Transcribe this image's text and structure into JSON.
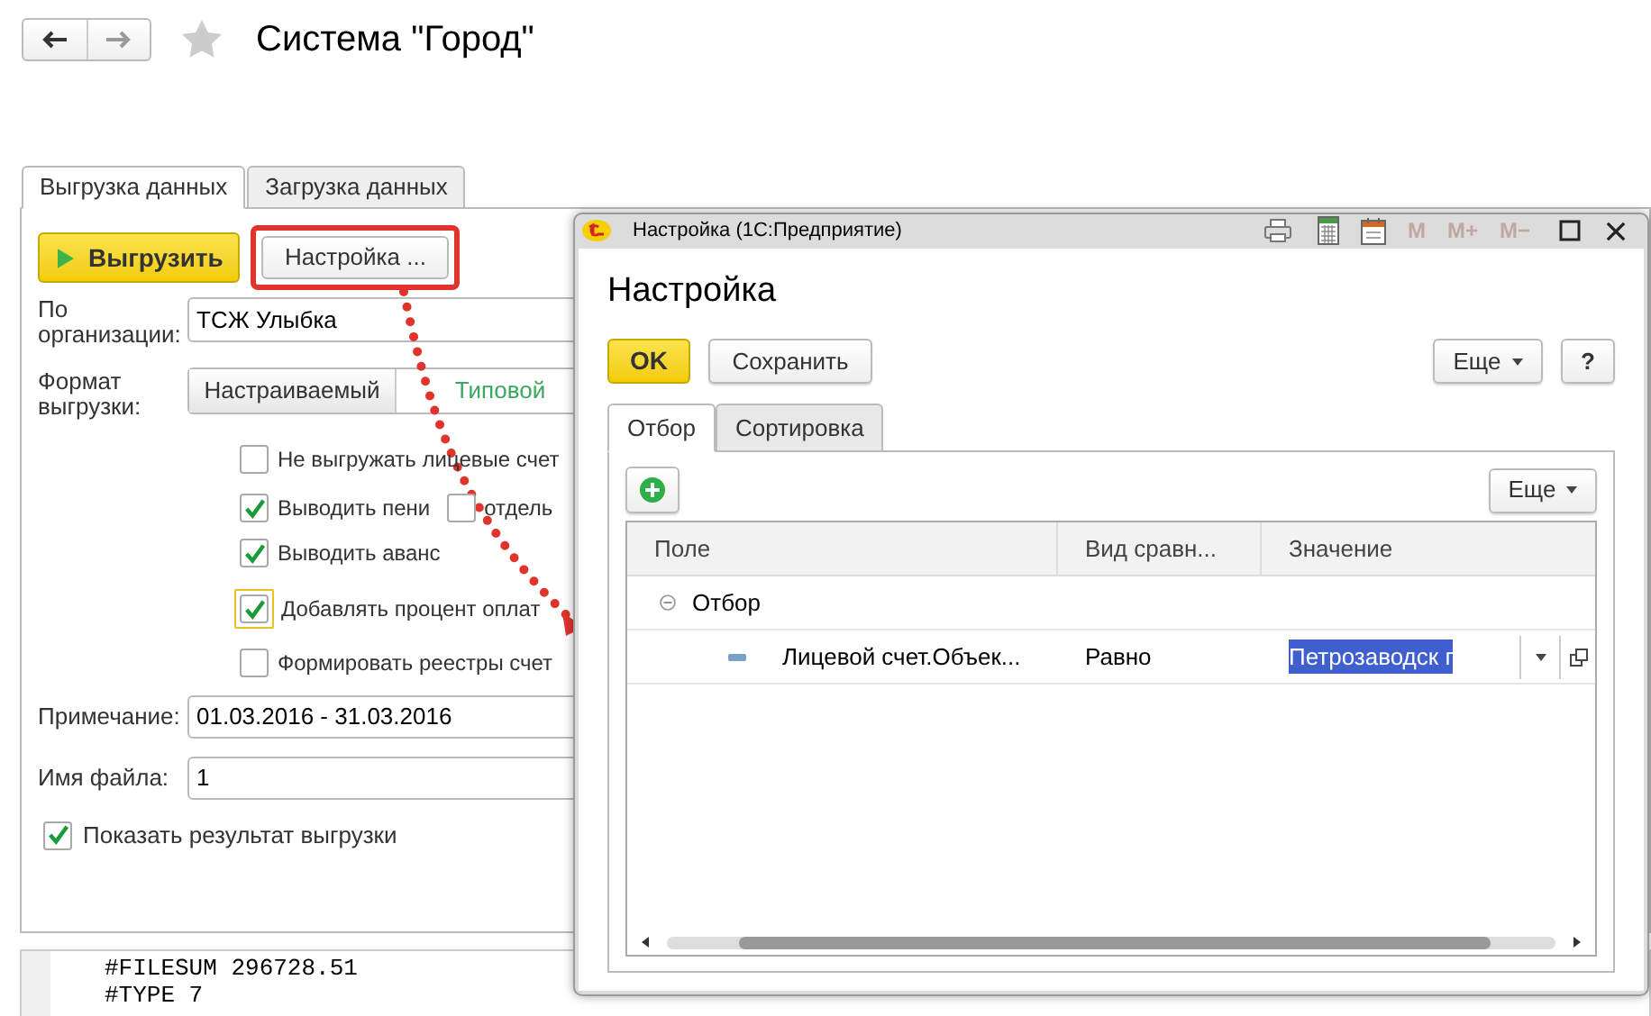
{
  "window": {
    "title": "Система \"Город\""
  },
  "tabs": [
    {
      "label": "Выгрузка данных",
      "selected": true
    },
    {
      "label": "Загрузка данных",
      "selected": false
    }
  ],
  "form": {
    "run_button": "Выгрузить",
    "settings_button": "Настройка ...",
    "organization": {
      "label": "По организации:",
      "value": "ТСЖ Улыбка"
    },
    "format": {
      "label": "Формат выгрузки:",
      "options": [
        {
          "label": "Настраиваемый",
          "selected": false
        },
        {
          "label": "Типовой",
          "selected": true
        }
      ]
    },
    "options": [
      {
        "label": "Не выгружать лицевые счет",
        "checked": false,
        "focused": false
      },
      {
        "label": "Выводить пени",
        "checked": true,
        "focused": false,
        "extra": {
          "label": "отдель",
          "checked": false
        }
      },
      {
        "label": "Выводить аванс",
        "checked": true,
        "focused": false
      },
      {
        "label": "Добавлять процент оплат",
        "checked": true,
        "focused": true
      },
      {
        "label": "Формировать реестры счет",
        "checked": false,
        "focused": false
      }
    ],
    "note": {
      "label": "Примечание:",
      "value": "01.03.2016 - 31.03.2016"
    },
    "file_name": {
      "label": "Имя файла:",
      "value": "1"
    },
    "show_result": {
      "label": "Показать результат выгрузки",
      "checked": true
    }
  },
  "output_lines": [
    "#FILESUM 296728.51",
    "#TYPE 7"
  ],
  "dialog": {
    "window_title": "Настройка  (1С:Предприятие)",
    "memory_buttons": [
      "M",
      "M+",
      "M−"
    ],
    "heading": "Настройка",
    "ok_button": "OK",
    "save_button": "Сохранить",
    "more_button": "Еще",
    "help_button": "?",
    "tabs": [
      {
        "label": "Отбор",
        "selected": true
      },
      {
        "label": "Сортировка",
        "selected": false
      }
    ],
    "table_more_button": "Еще",
    "columns": [
      "Поле",
      "Вид сравн...",
      "Значение"
    ],
    "rows": [
      {
        "field": "Отбор",
        "expanded": true,
        "children": [
          {
            "field": "Лицевой счет.Объек...",
            "comparison": "Равно",
            "value": "Петрозаводск г"
          }
        ]
      }
    ]
  }
}
